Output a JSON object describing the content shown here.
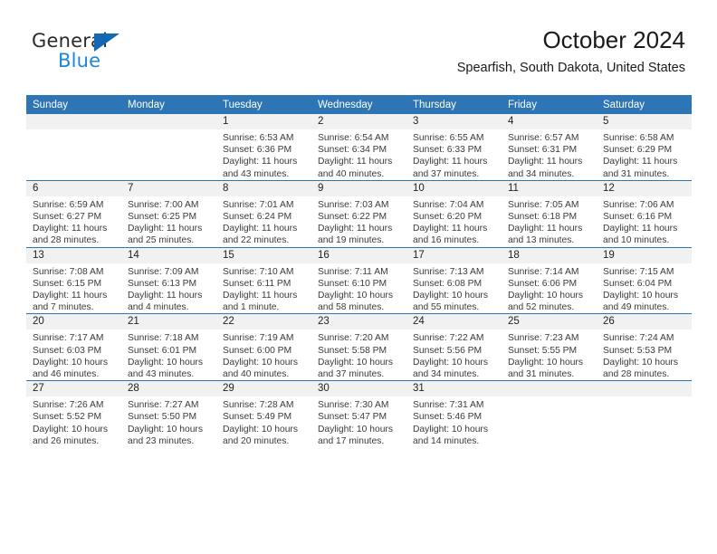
{
  "brand": {
    "name_top": "General",
    "name_bottom": "Blue",
    "accent_color": "#1268b3",
    "blue_text_color": "#1f86d8"
  },
  "header": {
    "title": "October 2024",
    "subtitle": "Spearfish, South Dakota, United States"
  },
  "theme": {
    "header_row_bg": "#2e75b6",
    "daynum_band_bg": "#f1f1f1",
    "text_color": "#222222"
  },
  "calendar": {
    "weekday_headers": [
      "Sunday",
      "Monday",
      "Tuesday",
      "Wednesday",
      "Thursday",
      "Friday",
      "Saturday"
    ],
    "weeks": [
      [
        {
          "day": "",
          "empty": true
        },
        {
          "day": "",
          "empty": true
        },
        {
          "day": "1",
          "sunrise": "Sunrise: 6:53 AM",
          "sunset": "Sunset: 6:36 PM",
          "daylight": "Daylight: 11 hours and 43 minutes."
        },
        {
          "day": "2",
          "sunrise": "Sunrise: 6:54 AM",
          "sunset": "Sunset: 6:34 PM",
          "daylight": "Daylight: 11 hours and 40 minutes."
        },
        {
          "day": "3",
          "sunrise": "Sunrise: 6:55 AM",
          "sunset": "Sunset: 6:33 PM",
          "daylight": "Daylight: 11 hours and 37 minutes."
        },
        {
          "day": "4",
          "sunrise": "Sunrise: 6:57 AM",
          "sunset": "Sunset: 6:31 PM",
          "daylight": "Daylight: 11 hours and 34 minutes."
        },
        {
          "day": "5",
          "sunrise": "Sunrise: 6:58 AM",
          "sunset": "Sunset: 6:29 PM",
          "daylight": "Daylight: 11 hours and 31 minutes."
        }
      ],
      [
        {
          "day": "6",
          "sunrise": "Sunrise: 6:59 AM",
          "sunset": "Sunset: 6:27 PM",
          "daylight": "Daylight: 11 hours and 28 minutes."
        },
        {
          "day": "7",
          "sunrise": "Sunrise: 7:00 AM",
          "sunset": "Sunset: 6:25 PM",
          "daylight": "Daylight: 11 hours and 25 minutes."
        },
        {
          "day": "8",
          "sunrise": "Sunrise: 7:01 AM",
          "sunset": "Sunset: 6:24 PM",
          "daylight": "Daylight: 11 hours and 22 minutes."
        },
        {
          "day": "9",
          "sunrise": "Sunrise: 7:03 AM",
          "sunset": "Sunset: 6:22 PM",
          "daylight": "Daylight: 11 hours and 19 minutes."
        },
        {
          "day": "10",
          "sunrise": "Sunrise: 7:04 AM",
          "sunset": "Sunset: 6:20 PM",
          "daylight": "Daylight: 11 hours and 16 minutes."
        },
        {
          "day": "11",
          "sunrise": "Sunrise: 7:05 AM",
          "sunset": "Sunset: 6:18 PM",
          "daylight": "Daylight: 11 hours and 13 minutes."
        },
        {
          "day": "12",
          "sunrise": "Sunrise: 7:06 AM",
          "sunset": "Sunset: 6:16 PM",
          "daylight": "Daylight: 11 hours and 10 minutes."
        }
      ],
      [
        {
          "day": "13",
          "sunrise": "Sunrise: 7:08 AM",
          "sunset": "Sunset: 6:15 PM",
          "daylight": "Daylight: 11 hours and 7 minutes."
        },
        {
          "day": "14",
          "sunrise": "Sunrise: 7:09 AM",
          "sunset": "Sunset: 6:13 PM",
          "daylight": "Daylight: 11 hours and 4 minutes."
        },
        {
          "day": "15",
          "sunrise": "Sunrise: 7:10 AM",
          "sunset": "Sunset: 6:11 PM",
          "daylight": "Daylight: 11 hours and 1 minute."
        },
        {
          "day": "16",
          "sunrise": "Sunrise: 7:11 AM",
          "sunset": "Sunset: 6:10 PM",
          "daylight": "Daylight: 10 hours and 58 minutes."
        },
        {
          "day": "17",
          "sunrise": "Sunrise: 7:13 AM",
          "sunset": "Sunset: 6:08 PM",
          "daylight": "Daylight: 10 hours and 55 minutes."
        },
        {
          "day": "18",
          "sunrise": "Sunrise: 7:14 AM",
          "sunset": "Sunset: 6:06 PM",
          "daylight": "Daylight: 10 hours and 52 minutes."
        },
        {
          "day": "19",
          "sunrise": "Sunrise: 7:15 AM",
          "sunset": "Sunset: 6:04 PM",
          "daylight": "Daylight: 10 hours and 49 minutes."
        }
      ],
      [
        {
          "day": "20",
          "sunrise": "Sunrise: 7:17 AM",
          "sunset": "Sunset: 6:03 PM",
          "daylight": "Daylight: 10 hours and 46 minutes."
        },
        {
          "day": "21",
          "sunrise": "Sunrise: 7:18 AM",
          "sunset": "Sunset: 6:01 PM",
          "daylight": "Daylight: 10 hours and 43 minutes."
        },
        {
          "day": "22",
          "sunrise": "Sunrise: 7:19 AM",
          "sunset": "Sunset: 6:00 PM",
          "daylight": "Daylight: 10 hours and 40 minutes."
        },
        {
          "day": "23",
          "sunrise": "Sunrise: 7:20 AM",
          "sunset": "Sunset: 5:58 PM",
          "daylight": "Daylight: 10 hours and 37 minutes."
        },
        {
          "day": "24",
          "sunrise": "Sunrise: 7:22 AM",
          "sunset": "Sunset: 5:56 PM",
          "daylight": "Daylight: 10 hours and 34 minutes."
        },
        {
          "day": "25",
          "sunrise": "Sunrise: 7:23 AM",
          "sunset": "Sunset: 5:55 PM",
          "daylight": "Daylight: 10 hours and 31 minutes."
        },
        {
          "day": "26",
          "sunrise": "Sunrise: 7:24 AM",
          "sunset": "Sunset: 5:53 PM",
          "daylight": "Daylight: 10 hours and 28 minutes."
        }
      ],
      [
        {
          "day": "27",
          "sunrise": "Sunrise: 7:26 AM",
          "sunset": "Sunset: 5:52 PM",
          "daylight": "Daylight: 10 hours and 26 minutes."
        },
        {
          "day": "28",
          "sunrise": "Sunrise: 7:27 AM",
          "sunset": "Sunset: 5:50 PM",
          "daylight": "Daylight: 10 hours and 23 minutes."
        },
        {
          "day": "29",
          "sunrise": "Sunrise: 7:28 AM",
          "sunset": "Sunset: 5:49 PM",
          "daylight": "Daylight: 10 hours and 20 minutes."
        },
        {
          "day": "30",
          "sunrise": "Sunrise: 7:30 AM",
          "sunset": "Sunset: 5:47 PM",
          "daylight": "Daylight: 10 hours and 17 minutes."
        },
        {
          "day": "31",
          "sunrise": "Sunrise: 7:31 AM",
          "sunset": "Sunset: 5:46 PM",
          "daylight": "Daylight: 10 hours and 14 minutes."
        },
        {
          "day": "",
          "empty": true
        },
        {
          "day": "",
          "empty": true
        }
      ]
    ]
  }
}
